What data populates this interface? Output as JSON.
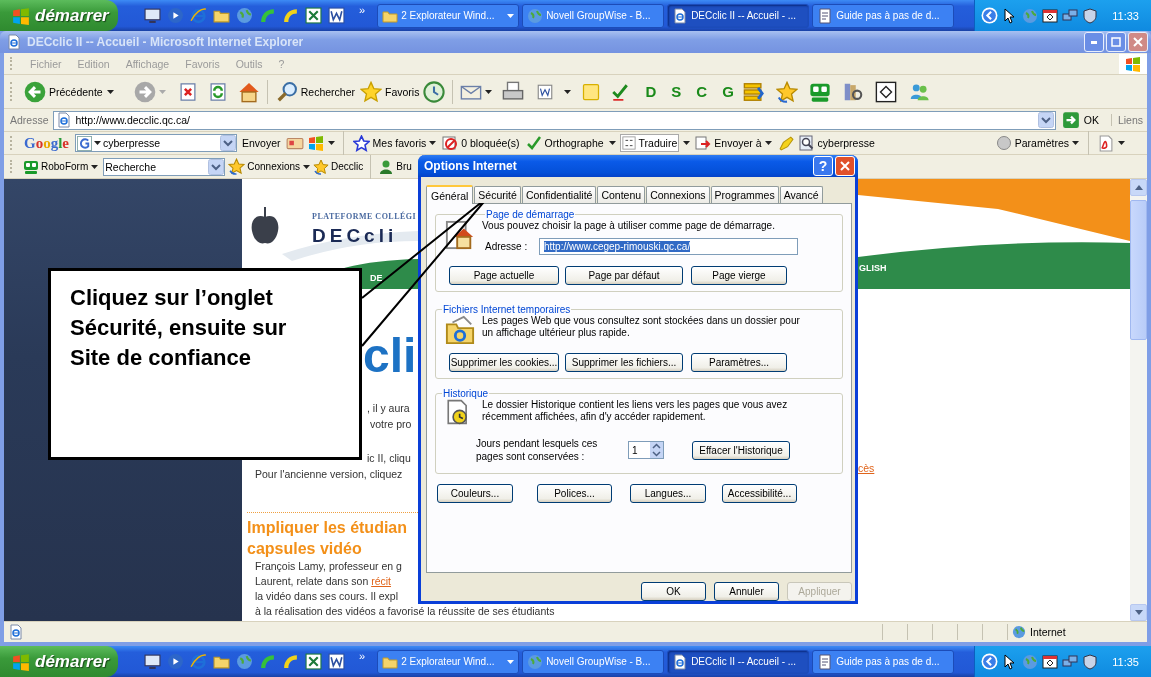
{
  "taskbar_top": {
    "start": "démarrer",
    "chevron": "»",
    "tasks": [
      {
        "label": "2 Explorateur Wind...",
        "grouped": true,
        "selected": false
      },
      {
        "label": "Novell GroupWise - B...",
        "grouped": false,
        "selected": false
      },
      {
        "label": "DECclic II -- Accueil - ...",
        "grouped": false,
        "selected": true
      },
      {
        "label": "Guide pas à pas de d...",
        "grouped": false,
        "selected": false
      }
    ],
    "clock": "11:33"
  },
  "window": {
    "title": "DECclic II -- Accueil - Microsoft Internet Explorer"
  },
  "menu": [
    "Fichier",
    "Edition",
    "Affichage",
    "Favoris",
    "Outils",
    "?"
  ],
  "toolbar": {
    "back": "Précédente",
    "search": "Rechercher",
    "favorites": "Favoris",
    "letters": [
      "D",
      "S",
      "C",
      "G"
    ]
  },
  "address_bar": {
    "label": "Adresse",
    "value": "http://www.decclic.qc.ca/",
    "go": "OK",
    "links": "Liens"
  },
  "google_bar": {
    "logo": "Google",
    "search": "cyberpresse",
    "send": "Envoyer",
    "favorites": "Mes favoris",
    "blocked": "0 bloquée(s)",
    "spelling": "Orthographe",
    "translate": "Traduire",
    "send_to": "Envoyer à",
    "site": "cyberpresse",
    "settings": "Paramètres"
  },
  "roboform_bar": {
    "brand": "RoboForm",
    "search": "Recherche",
    "connections": "Connexions",
    "bookmarks": [
      "Decclic",
      "Bru"
    ]
  },
  "web_page": {
    "banner": {
      "tagline": "PLATEFORME COLLÉGI",
      "logo": "DECcli",
      "nav": "DE",
      "language": "GLISH"
    },
    "title": "cli",
    "intro": [
      ", il y aura",
      "votre pro",
      "ic II, cliqu",
      "Pour l'ancienne version, cliquez"
    ],
    "link": "cès",
    "headline_lines": [
      "Impliquer les étudian",
      "capsules vidéo"
    ],
    "article": [
      {
        "text": "François Lamy, professeur en g"
      },
      {
        "text": "Laurent, relate dans son ",
        "link": "récit"
      },
      {
        "text": "la vidéo dans ses cours. Il expl"
      },
      {
        "text": "à la réalisation des vidéos a favorisé la réussite de ses étudiants"
      }
    ]
  },
  "callout": {
    "text": "Cliquez sur l’onglet Sécurité, ensuite sur Site de confiance"
  },
  "dialog": {
    "title": "Options Internet",
    "help": "?",
    "tabs": [
      {
        "label": "Général",
        "selected": true
      },
      {
        "label": "Sécurité",
        "selected": false
      },
      {
        "label": "Confidentialité",
        "selected": false
      },
      {
        "label": "Contenu",
        "selected": false
      },
      {
        "label": "Connexions",
        "selected": false
      },
      {
        "label": "Programmes",
        "selected": false
      },
      {
        "label": "Avancé",
        "selected": false
      }
    ],
    "home_page": {
      "legend": "Page de démarrage",
      "text": "Vous pouvez choisir la page à utiliser comme page de démarrage.",
      "address_label": "Adresse :",
      "address": "http://www.cegep-rimouski.qc.ca/",
      "buttons": [
        "Page actuelle",
        "Page par défaut",
        "Page vierge"
      ]
    },
    "temp_files": {
      "legend": "Fichiers Internet temporaires",
      "text": "Les pages Web que vous consultez sont stockées dans un dossier pour un affichage ultérieur plus rapide.",
      "buttons": [
        "Supprimer les cookies...",
        "Supprimer les fichiers...",
        "Paramètres..."
      ]
    },
    "history": {
      "legend": "Historique",
      "text": "Le dossier Historique contient les liens vers les pages que vous avez récemment affichées, afin d'y accéder rapidement.",
      "days_label": "Jours pendant lesquels ces pages sont conservées :",
      "days": "1",
      "clear": "Effacer l'Historique"
    },
    "bottom_buttons": [
      "Couleurs...",
      "Polices...",
      "Langues...",
      "Accessibilité..."
    ],
    "footer_buttons": [
      {
        "label": "OK",
        "disabled": false
      },
      {
        "label": "Annuler",
        "disabled": false
      },
      {
        "label": "Appliquer",
        "disabled": true
      }
    ]
  },
  "status_bar": {
    "zone": "Internet"
  },
  "taskbar_bottom": {
    "start": "démarrer",
    "chevron": "»",
    "tasks": [
      {
        "label": "2 Explorateur Wind...",
        "grouped": true,
        "selected": false
      },
      {
        "label": "Novell GroupWise - B...",
        "grouped": false,
        "selected": false
      },
      {
        "label": "DECclic II -- Accueil - ...",
        "grouped": false,
        "selected": true
      },
      {
        "label": "Guide pas à pas de d...",
        "grouped": false,
        "selected": false
      }
    ],
    "clock": "11:35"
  }
}
